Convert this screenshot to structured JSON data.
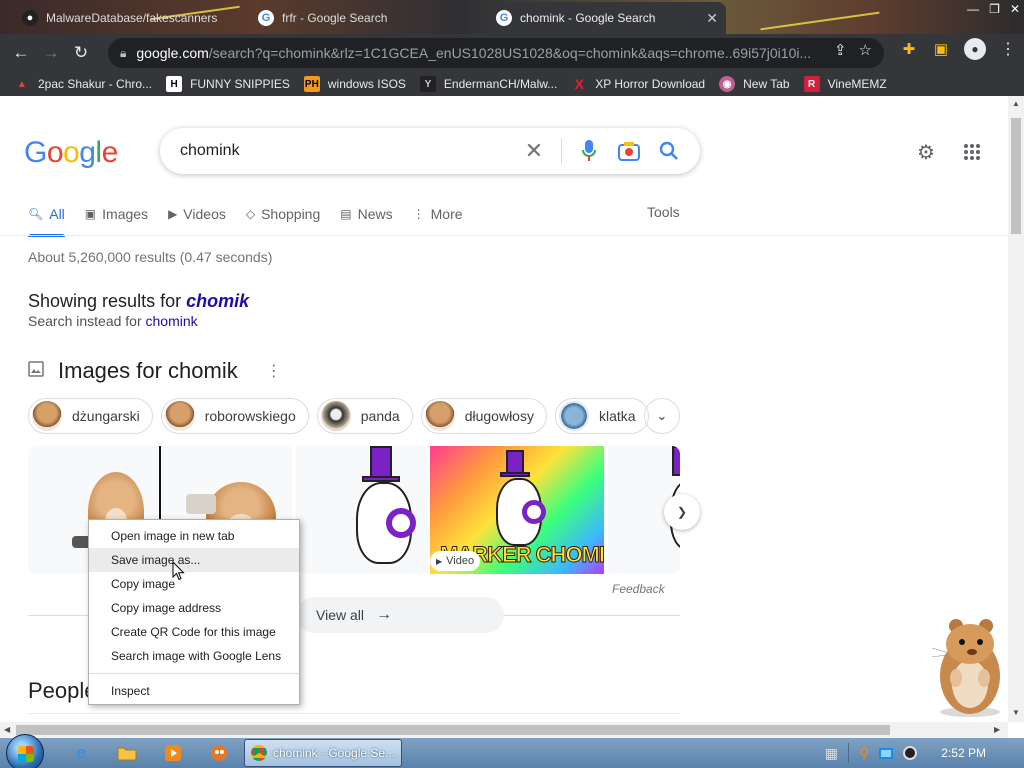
{
  "browser": {
    "tabs": [
      {
        "label": "MalwareDatabase/fakescanners",
        "active": false
      },
      {
        "label": "frfr - Google Search",
        "active": false
      },
      {
        "label": "chomink - Google Search",
        "active": true
      }
    ],
    "url_host": "google.com",
    "url_path": "/search?q=chomink&rlz=1C1GCEA_enUS1028US1028&oq=chomink&aqs=chrome..69i57j0i10i...",
    "bookmarks": [
      {
        "label": "2pac Shakur - Chro...",
        "icon": "flame-icon",
        "color": "#d24a3a"
      },
      {
        "label": "FUNNY SNIPPIES",
        "icon": "H",
        "color": "#ffffff"
      },
      {
        "label": "windows ISOS",
        "icon": "PH",
        "color": "#f7971d"
      },
      {
        "label": "EndermanCH/Malw...",
        "icon": "Y",
        "color": "#cccccc"
      },
      {
        "label": "XP Horror Download",
        "icon": "X",
        "color": "#e0202f"
      },
      {
        "label": "New Tab",
        "icon": "globe-icon",
        "color": "#c06090"
      },
      {
        "label": "VineMEMZ",
        "icon": "R",
        "color": "#d21f3c"
      }
    ]
  },
  "google": {
    "logo_letters": [
      {
        "ch": "G",
        "color": "#4285f4"
      },
      {
        "ch": "o",
        "color": "#ea4335"
      },
      {
        "ch": "o",
        "color": "#fbbc05"
      },
      {
        "ch": "g",
        "color": "#4285f4"
      },
      {
        "ch": "l",
        "color": "#34a853"
      },
      {
        "ch": "e",
        "color": "#ea4335"
      }
    ],
    "query": "chomink",
    "tabs": [
      {
        "label": "All",
        "icon": "search-icon",
        "selected": true
      },
      {
        "label": "Images",
        "icon": "image-icon",
        "selected": false
      },
      {
        "label": "Videos",
        "icon": "play-icon",
        "selected": false
      },
      {
        "label": "Shopping",
        "icon": "tag-icon",
        "selected": false
      },
      {
        "label": "News",
        "icon": "news-icon",
        "selected": false
      },
      {
        "label": "More",
        "icon": "dots-vertical-icon",
        "selected": false
      }
    ],
    "tools_label": "Tools",
    "result_stats": "About 5,260,000 results (0.47 seconds)",
    "showing_prefix": "Showing results for ",
    "showing_term": "chomik",
    "instead_prefix": "Search instead for ",
    "instead_term": "chomink",
    "images_heading": "Images for chomik",
    "chips": [
      "dżungarski",
      "roborowskiego",
      "panda",
      "długowłosy",
      "klatka"
    ],
    "video_badge": "Video",
    "thumb_caption": "MARKER CHOMIK",
    "feedback": "Feedback",
    "view_all": "View all",
    "people_heading": "People"
  },
  "context_menu": {
    "items_top": [
      "Open image in new tab",
      "Save image as...",
      "Copy image",
      "Copy image address",
      "Create QR Code for this image",
      "Search image with Google Lens"
    ],
    "highlighted_index": 1,
    "inspect": "Inspect"
  },
  "taskbar": {
    "chrome_task": "chomink - Google Se...",
    "clock": "2:52 PM"
  }
}
